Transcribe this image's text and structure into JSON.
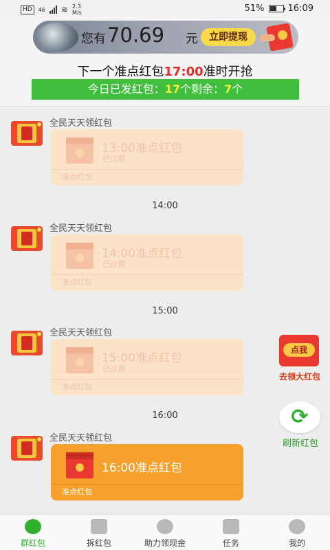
{
  "status_bar": {
    "hd": "HD",
    "network": "46",
    "speed_value": "2.3",
    "speed_unit": "M/s",
    "battery": "51%",
    "battery_level": 0.51,
    "time": "16:09"
  },
  "banner": {
    "label": "您有",
    "amount": "70.69",
    "unit": "元",
    "withdraw_button": "立即提现"
  },
  "schedule": {
    "prefix": "下一个准点红包",
    "time": "17:00",
    "suffix": "准时开抢"
  },
  "today": {
    "sent_label": "今日已发红包：",
    "sent_count": "17",
    "remaining_label": "个剩余：",
    "remaining_count": "7",
    "unit": "个"
  },
  "messages": [
    {
      "sender": "全民天天领红包",
      "title": "13:00准点红包",
      "status": "已过期",
      "type": "准点红包",
      "expired": true
    },
    {
      "timestamp": "14:00",
      "sender": "全民天天领红包",
      "title": "14:00准点红包",
      "status": "已过期",
      "type": "准点红包",
      "expired": true
    },
    {
      "timestamp": "15:00",
      "sender": "全民天天领红包",
      "title": "15:00准点红包",
      "status": "已过期",
      "type": "准点红包",
      "expired": true
    },
    {
      "timestamp": "16:00",
      "sender": "全民天天领红包",
      "title": "16:00准点红包",
      "status": "",
      "type": "准点红包",
      "expired": false
    }
  ],
  "float_gift": {
    "tag": "点我",
    "caption": "去领大红包"
  },
  "refresh": {
    "label": "刷新红包",
    "icon": "refresh-icon"
  },
  "nav": [
    {
      "label": "群红包",
      "icon": "chat-bubble-icon",
      "active": true
    },
    {
      "label": "拆红包",
      "icon": "red-packet-icon",
      "active": false
    },
    {
      "label": "助力领现金",
      "icon": "yuan-coin-icon",
      "active": false
    },
    {
      "label": "任务",
      "icon": "task-icon",
      "active": false
    },
    {
      "label": "我的",
      "icon": "user-icon",
      "active": false
    }
  ],
  "colors": {
    "accent_green": "#3fbf3d",
    "highlight_red": "#e62d2d",
    "highlight_yellow": "#f8ec3a",
    "active_packet": "#f5a02b",
    "expired_packet": "#fbe3c8"
  }
}
